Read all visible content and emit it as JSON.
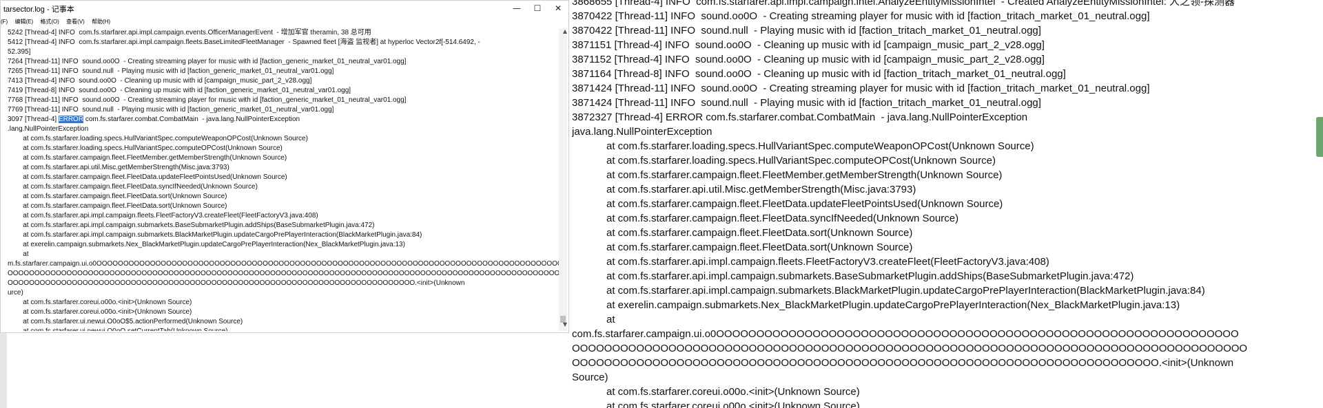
{
  "notepad": {
    "title": "tarsector.log - 记事本",
    "controls": {
      "minimize": "—",
      "maximize": "☐",
      "close": "✕"
    },
    "menu": [
      "(F)",
      "编辑(E)",
      "格式(O)",
      "查看(V)",
      "帮助(H)"
    ],
    "lines": [
      "5242 [Thread-4] INFO  com.fs.starfarer.api.impl.campaign.events.OfficerManagerEvent  - 增加军官 theramin, 38 总可用",
      "5412 [Thread-4] INFO  com.fs.starfarer.api.impl.campaign.fleets.BaseLimitedFleetManager  - Spawned fleet [海盗 监视者] at hyperloc Vector2f[-514.6492, -",
      "52.395]",
      "7264 [Thread-11] INFO  sound.oo0O  - Creating streaming player for music with id [faction_generic_market_01_neutral_var01.ogg]",
      "7265 [Thread-11] INFO  sound.null  - Playing music with id [faction_generic_market_01_neutral_var01.ogg]",
      "7413 [Thread-4] INFO  sound.oo0O  - Cleaning up music with id [campaign_music_part_2_v28.ogg]",
      "7419 [Thread-8] INFO  sound.oo0O  - Cleaning up music with id [faction_generic_market_01_neutral_var01.ogg]",
      "7768 [Thread-11] INFO  sound.oo0O  - Creating streaming player for music with id [faction_generic_market_01_neutral_var01.ogg]",
      "7769 [Thread-11] INFO  sound.null  - Playing music with id [faction_generic_market_01_neutral_var01.ogg]",
      "__ERRORLINE__",
      ".lang.NullPointerException",
      "        at com.fs.starfarer.loading.specs.HullVariantSpec.computeWeaponOPCost(Unknown Source)",
      "        at com.fs.starfarer.loading.specs.HullVariantSpec.computeOPCost(Unknown Source)",
      "        at com.fs.starfarer.campaign.fleet.FleetMember.getMemberStrength(Unknown Source)",
      "        at com.fs.starfarer.api.util.Misc.getMemberStrength(Misc.java:3793)",
      "        at com.fs.starfarer.campaign.fleet.FleetData.updateFleetPointsUsed(Unknown Source)",
      "        at com.fs.starfarer.campaign.fleet.FleetData.syncIfNeeded(Unknown Source)",
      "        at com.fs.starfarer.campaign.fleet.FleetData.sort(Unknown Source)",
      "        at com.fs.starfarer.campaign.fleet.FleetData.sort(Unknown Source)",
      "        at com.fs.starfarer.api.impl.campaign.fleets.FleetFactoryV3.createFleet(FleetFactoryV3.java:408)",
      "        at com.fs.starfarer.api.impl.campaign.submarkets.BaseSubmarketPlugin.addShips(BaseSubmarketPlugin.java:472)",
      "        at com.fs.starfarer.api.impl.campaign.submarkets.BlackMarketPlugin.updateCargoPrePlayerInteraction(BlackMarketPlugin.java:84)",
      "        at exerelin.campaign.submarkets.Nex_BlackMarketPlugin.updateCargoPrePlayerInteraction(Nex_BlackMarketPlugin.java:13)",
      "        at",
      "m.fs.starfarer.campaign.ui.o0OOOOOOOOOOOOOOOOOOOOOOOOOOOOOOOOOOOOOOOOOOOOOOOOOOOOOOOOOOOOOOOOOOOOOOOOOOOOOOOOOOOOOOOO",
      "OOOOOOOOOOOOOOOOOOOOOOOOOOOOOOOOOOOOOOOOOOOOOOOOOOOOOOOOOOOOOOOOOOOOOOOOOOOOOOOOOOOOOOOOOOOOOOOOOOOOOOOOO",
      "OOOOOOOOOOOOOOOOOOOOOOOOOOOOOOOOOOOOOOOOOOOOOOOOOOOOOOOOOOOOOOOOOOOOOOOOOOOO.<init>(Unknown",
      "urce)",
      "        at com.fs.starfarer.coreui.o00o.<init>(Unknown Source)",
      "        at com.fs.starfarer.coreui.o00o.<init>(Unknown Source)",
      "        at com.fs.starfarer.ui.newui.O0oO$5.actionPerformed(Unknown Source)",
      "        at com.fs.starfarer.ui.newui.O0oO.setCurrentTab(Unknown Source)"
    ],
    "error_line": {
      "prefix": "3097 [Thread-4] ",
      "selected": "ERROR",
      "suffix": " com.fs.starfarer.combat.CombatMain  - java.lang.NullPointerException"
    }
  },
  "log": {
    "lines": [
      "3868655 [Thread-4] INFO  com.fs.starfarer.api.impl.campaign.intel.AnalyzeEntityMissionIntel  - Created AnalyzeEntityMissionIntel: 人之领-探测器",
      "3870422 [Thread-11] INFO  sound.oo0O  - Creating streaming player for music with id [faction_tritach_market_01_neutral.ogg]",
      "3870422 [Thread-11] INFO  sound.null  - Playing music with id [faction_tritach_market_01_neutral.ogg]",
      "3871151 [Thread-4] INFO  sound.oo0O  - Cleaning up music with id [campaign_music_part_2_v28.ogg]",
      "3871152 [Thread-4] INFO  sound.oo0O  - Cleaning up music with id [campaign_music_part_2_v28.ogg]",
      "3871164 [Thread-8] INFO  sound.oo0O  - Cleaning up music with id [faction_tritach_market_01_neutral.ogg]",
      "3871424 [Thread-11] INFO  sound.oo0O  - Creating streaming player for music with id [faction_tritach_market_01_neutral.ogg]",
      "3871424 [Thread-11] INFO  sound.null  - Playing music with id [faction_tritach_market_01_neutral.ogg]",
      "3872327 [Thread-4] ERROR com.fs.starfarer.combat.CombatMain  - java.lang.NullPointerException",
      "java.lang.NullPointerException",
      "            at com.fs.starfarer.loading.specs.HullVariantSpec.computeWeaponOPCost(Unknown Source)",
      "            at com.fs.starfarer.loading.specs.HullVariantSpec.computeOPCost(Unknown Source)",
      "            at com.fs.starfarer.campaign.fleet.FleetMember.getMemberStrength(Unknown Source)",
      "            at com.fs.starfarer.api.util.Misc.getMemberStrength(Misc.java:3793)",
      "            at com.fs.starfarer.campaign.fleet.FleetData.updateFleetPointsUsed(Unknown Source)",
      "            at com.fs.starfarer.campaign.fleet.FleetData.syncIfNeeded(Unknown Source)",
      "            at com.fs.starfarer.campaign.fleet.FleetData.sort(Unknown Source)",
      "            at com.fs.starfarer.campaign.fleet.FleetData.sort(Unknown Source)",
      "            at com.fs.starfarer.api.impl.campaign.fleets.FleetFactoryV3.createFleet(FleetFactoryV3.java:408)",
      "            at com.fs.starfarer.api.impl.campaign.submarkets.BaseSubmarketPlugin.addShips(BaseSubmarketPlugin.java:472)",
      "            at com.fs.starfarer.api.impl.campaign.submarkets.BlackMarketPlugin.updateCargoPrePlayerInteraction(BlackMarketPlugin.java:84)",
      "            at exerelin.campaign.submarkets.Nex_BlackMarketPlugin.updateCargoPrePlayerInteraction(Nex_BlackMarketPlugin.java:13)",
      "            at",
      "com.fs.starfarer.campaign.ui.o0OOOOOOOOOOOOOOOOOOOOOOOOOOOOOOOOOOOOOOOOOOOOOOOOOOOOOOOOOOOOOOOOO",
      "OOOOOOOOOOOOOOOOOOOOOOOOOOOOOOOOOOOOOOOOOOOOOOOOOOOOOOOOOOOOOOOOOOOOOOOOOOOOOOOOOOOO",
      "OOOOOOOOOOOOOOOOOOOOOOOOOOOOOOOOOOOOOOOOOOOOOOOOOOOOOOOOOOOOOOOOOOOOOOOOO.<init>(Unknown",
      "Source)",
      "            at com.fs.starfarer.coreui.o00o.<init>(Unknown Source)",
      "            at com.fs.starfarer.coreui.o00o.<init>(Unknown Source)"
    ]
  },
  "colors": {
    "selection": "#2f78d6",
    "text": "#111111",
    "edge_tab": "#6fa36f"
  }
}
